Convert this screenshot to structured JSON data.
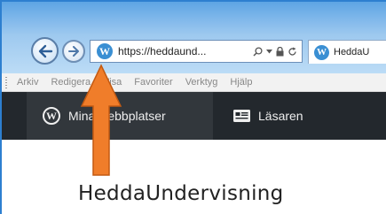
{
  "browser": {
    "address_url": "https://heddaund...",
    "tab_title": "HeddaU",
    "site_icon_glyph": "W"
  },
  "menu": {
    "items": [
      "Arkiv",
      "Redigera",
      "Visa",
      "Favoriter",
      "Verktyg",
      "Hjälp"
    ]
  },
  "admin_bar": {
    "logo_glyph": "W",
    "my_sites_label": "Mina webbplatser",
    "reader_label": "Läsaren"
  },
  "site": {
    "title": "HeddaUndervisning"
  },
  "annotation": {
    "arrow_color": "#f07d2a",
    "arrow_icon": "up-arrow-icon"
  },
  "colors": {
    "admin_bar_bg": "#23282d",
    "admin_item_bg": "#32373c",
    "chrome_blue": "#7db6ea"
  }
}
